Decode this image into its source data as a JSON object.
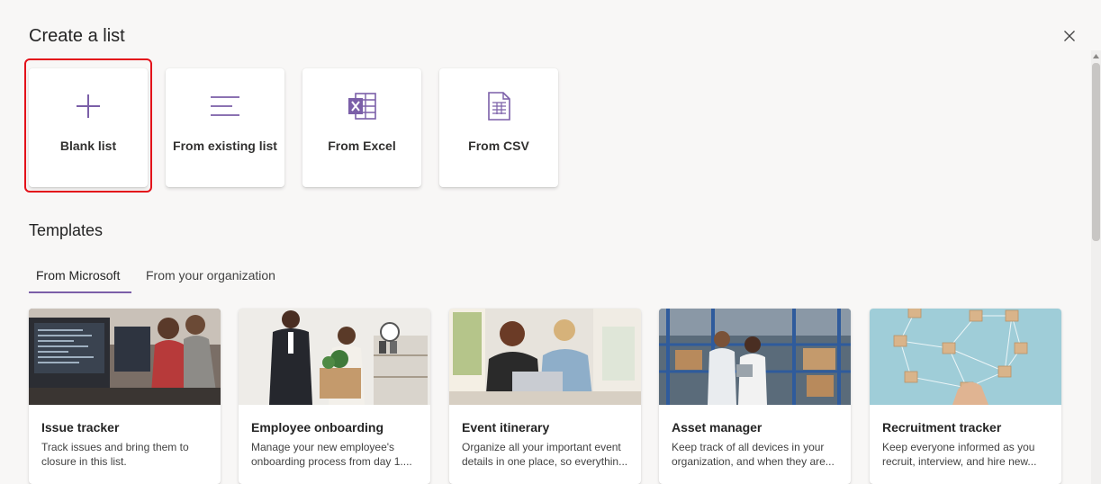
{
  "dialog": {
    "title": "Create a list",
    "close_icon": "close-icon"
  },
  "create_options": [
    {
      "label": "Blank list",
      "icon": "plus-icon",
      "selected": true
    },
    {
      "label": "From existing list",
      "icon": "lines-icon",
      "selected": false
    },
    {
      "label": "From Excel",
      "icon": "excel-icon",
      "selected": false
    },
    {
      "label": "From CSV",
      "icon": "csv-file-icon",
      "selected": false
    }
  ],
  "templates": {
    "title": "Templates",
    "tabs": [
      {
        "label": "From Microsoft",
        "active": true
      },
      {
        "label": "From your organization",
        "active": false
      }
    ],
    "items": [
      {
        "title": "Issue tracker",
        "description": "Track issues and bring them to closure in this list.",
        "image": "people-at-computers-photo"
      },
      {
        "title": "Employee onboarding",
        "description": "Manage your new employee's onboarding process from day 1....",
        "image": "office-welcome-photo"
      },
      {
        "title": "Event itinerary",
        "description": "Organize all your important event details in one place, so everythin...",
        "image": "women-at-laptop-photo"
      },
      {
        "title": "Asset manager",
        "description": "Keep track of all devices in your organization, and when they are...",
        "image": "warehouse-photo"
      },
      {
        "title": "Recruitment tracker",
        "description": "Keep everyone informed as you recruit, interview, and hire new...",
        "image": "network-blocks-photo"
      }
    ]
  },
  "colors": {
    "accent": "#7b5fa8",
    "selection": "#e3111a",
    "background": "#f8f7f6"
  }
}
